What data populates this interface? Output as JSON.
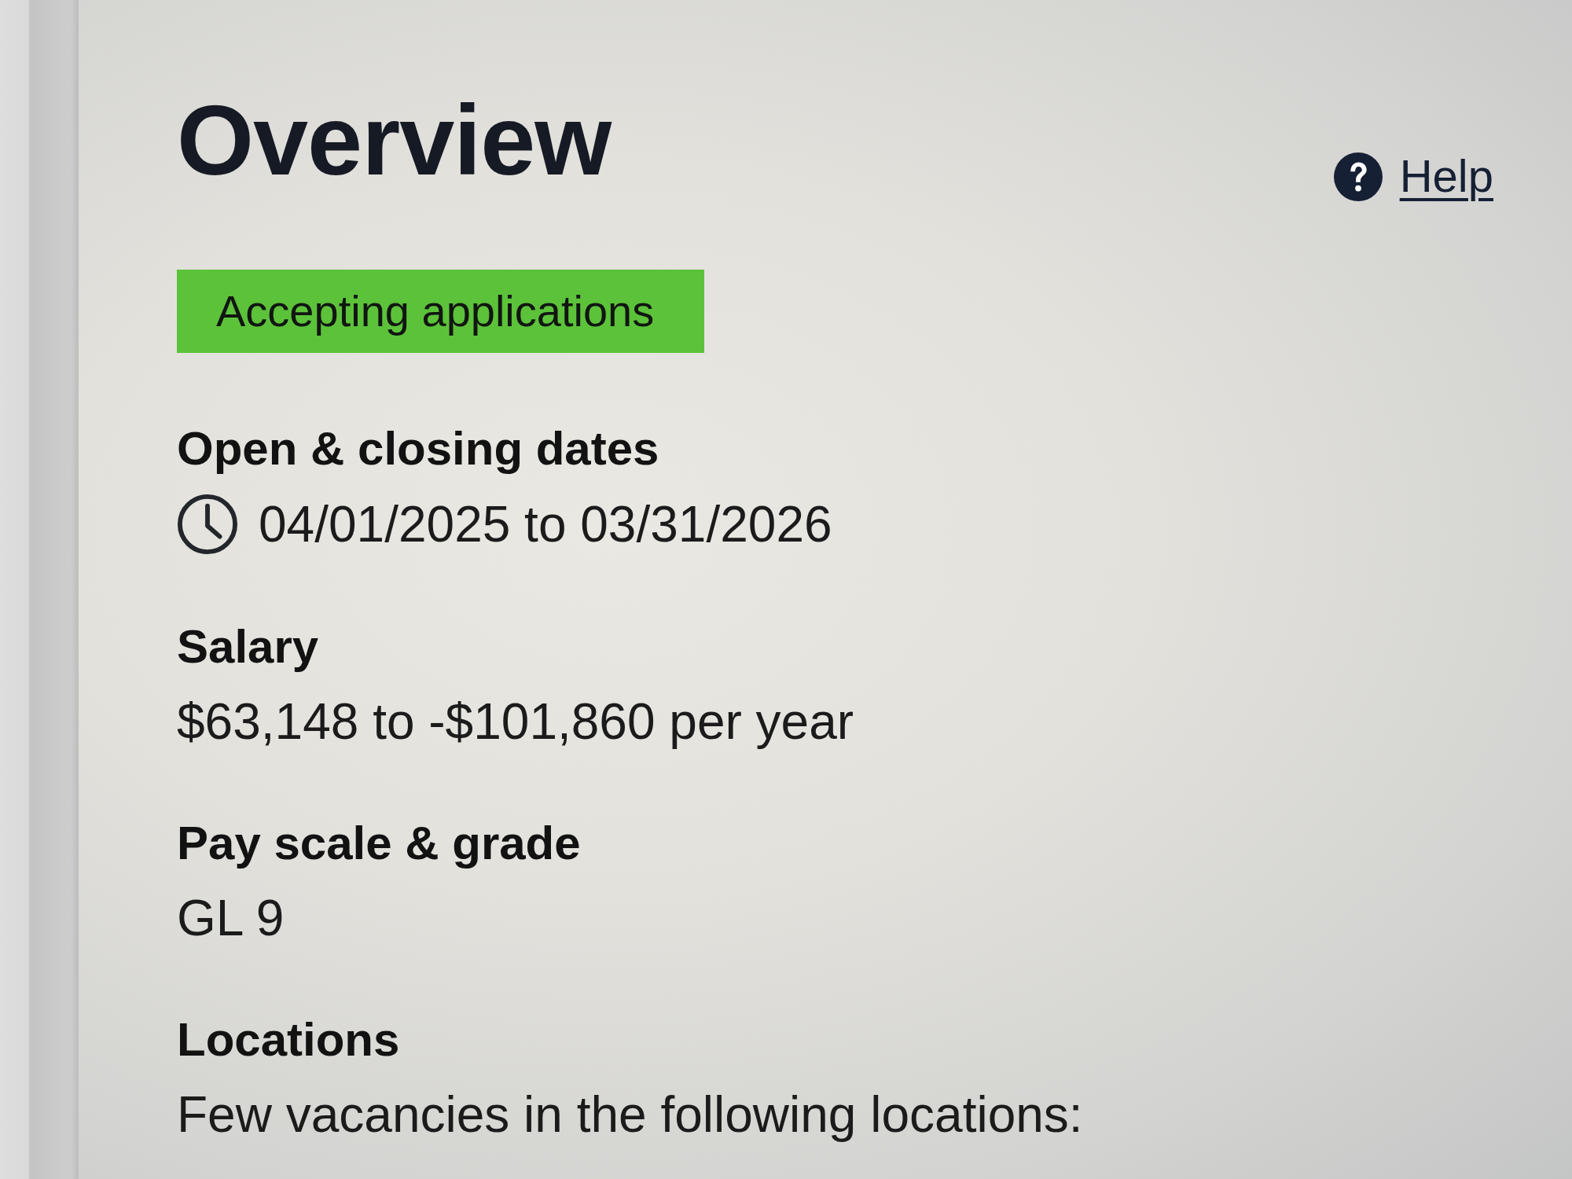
{
  "header": {
    "title": "Overview",
    "help_link": "Help"
  },
  "status_badge": "Accepting applications",
  "sections": [
    {
      "kind": "dates",
      "heading": "Open & closing dates",
      "value": "04/01/2025 to 03/31/2026"
    },
    {
      "kind": "text",
      "heading": "Salary",
      "value": "$63,148 to -$101,860 per year"
    },
    {
      "kind": "text",
      "heading": "Pay scale & grade",
      "value": "GL 9"
    },
    {
      "kind": "text",
      "heading": "Locations",
      "value": "Few vacancies in the following locations:"
    }
  ]
}
